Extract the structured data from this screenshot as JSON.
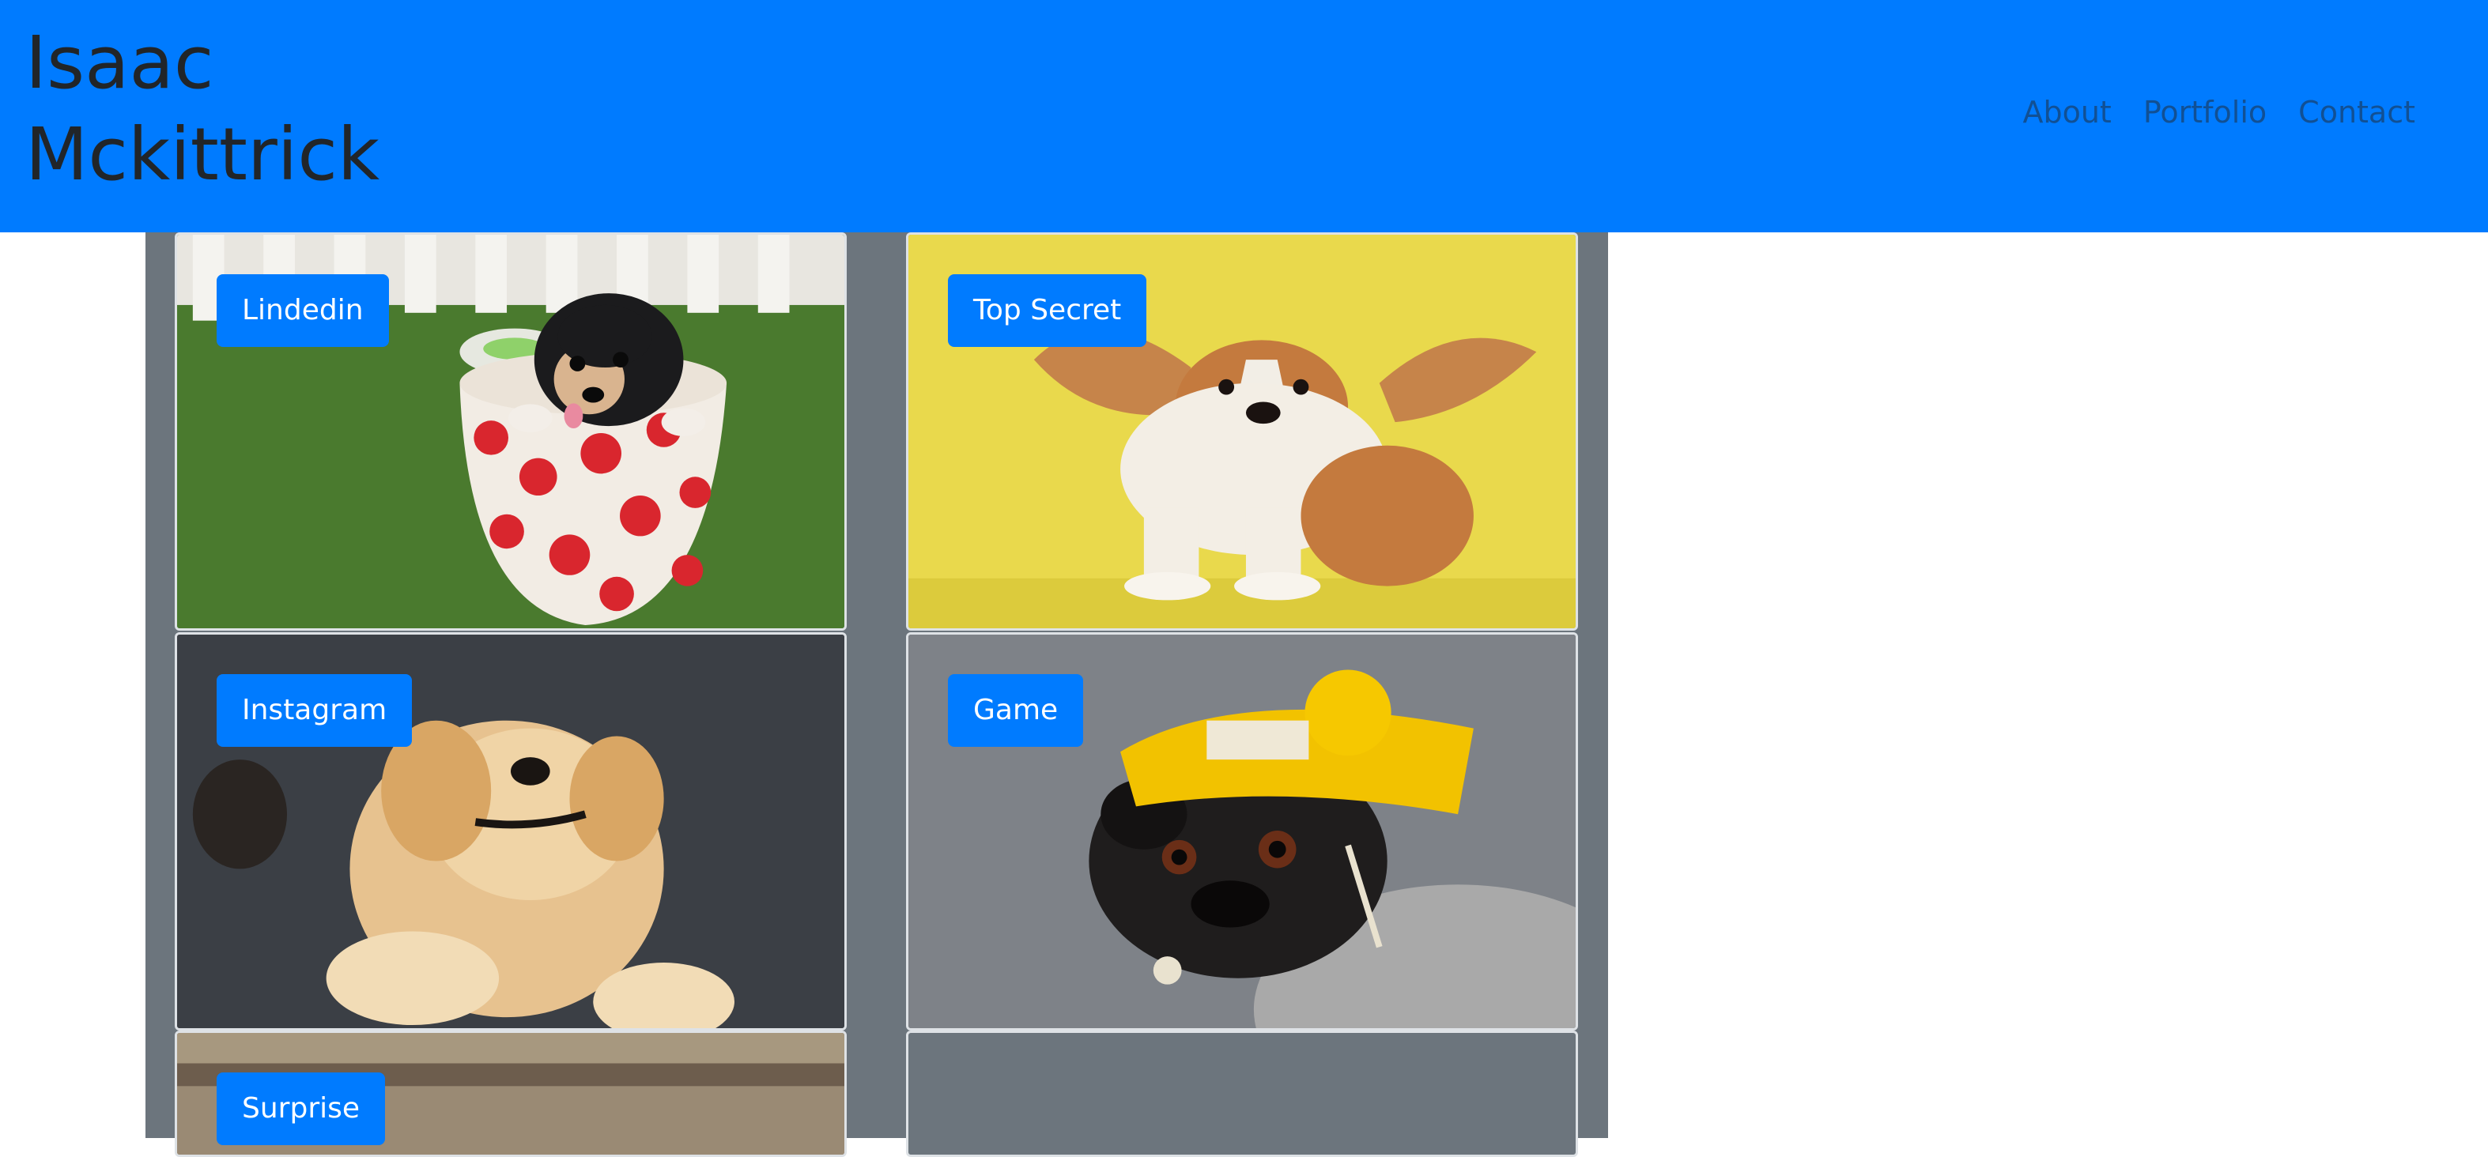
{
  "header": {
    "brand_line1": "Isaac",
    "brand_line2": "Mckittrick",
    "nav": [
      "About",
      "Portfolio",
      "Contact"
    ]
  },
  "cards": [
    {
      "label": "Lindedin",
      "image": "puppy-in-polka-dot-cup"
    },
    {
      "label": "Top Secret",
      "image": "corgi-on-yellow-background"
    },
    {
      "label": "Instagram",
      "image": "golden-retriever-lying-on-back"
    },
    {
      "label": "Game",
      "image": "pug-in-yellow-beanie"
    },
    {
      "label": "Surprise",
      "image": "blurred-dog-photo"
    }
  ],
  "colors": {
    "accent": "#007bff",
    "panel": "#6c757d",
    "brand_text": "#212529"
  }
}
